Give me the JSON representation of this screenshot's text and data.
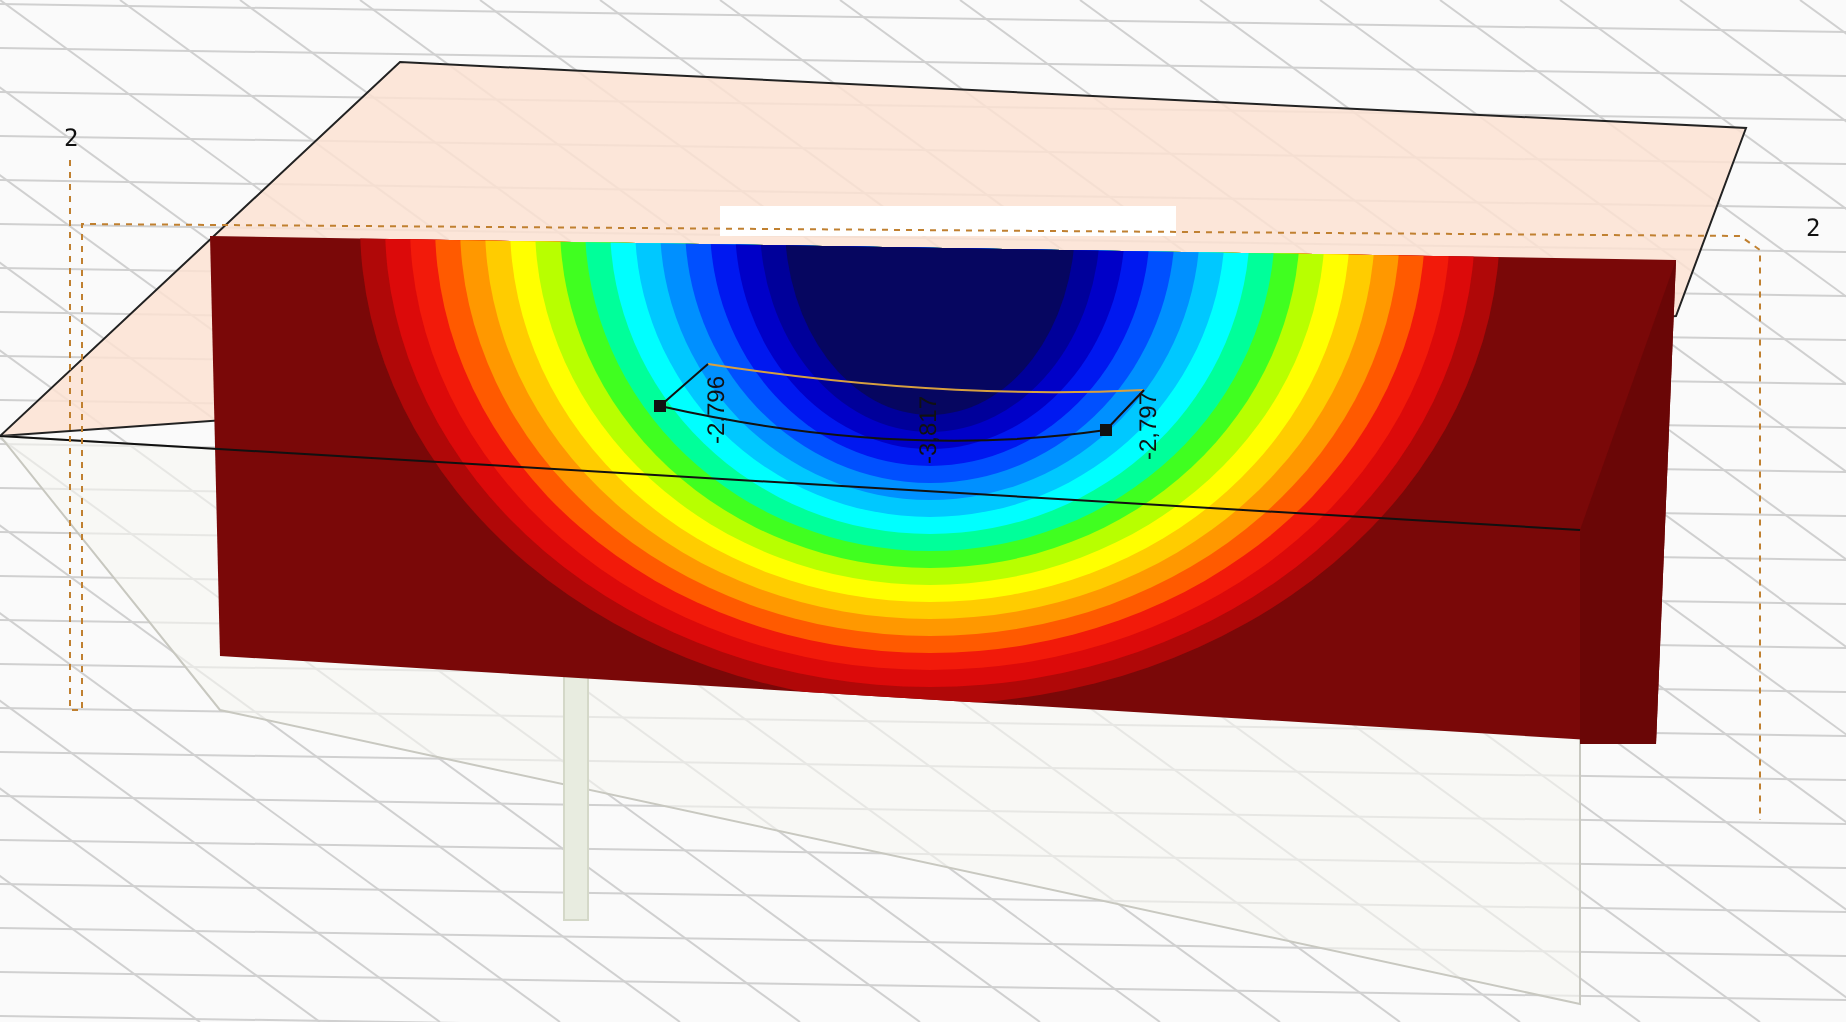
{
  "axis_labels": [
    {
      "text": "2"
    },
    {
      "text": "2"
    }
  ],
  "result_values": [
    {
      "text": "-2,796"
    },
    {
      "text": "-3,817"
    },
    {
      "text": "-2,797"
    }
  ]
}
